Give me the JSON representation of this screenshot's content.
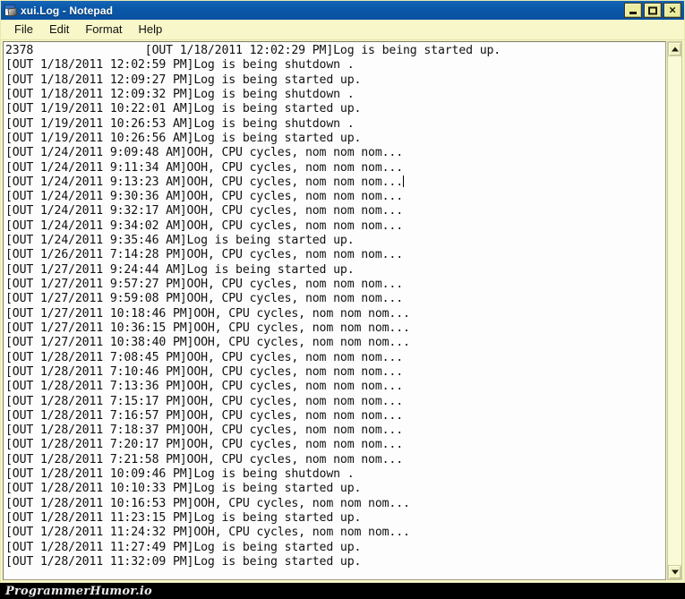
{
  "window": {
    "title": "xui.Log - Notepad",
    "icon": "notepad-icon",
    "colors": {
      "titlebar": "#0a57a8",
      "menubar": "#f7f7c9",
      "window_chrome": "#f2f2c4",
      "text_area": "#fdfdfd",
      "text": "#111111",
      "watermark_bar": "#000000"
    }
  },
  "window_buttons": {
    "minimize": "_",
    "maximize": "□",
    "close": "×"
  },
  "menu": {
    "items": [
      {
        "label": "File"
      },
      {
        "label": "Edit"
      },
      {
        "label": "Format"
      },
      {
        "label": "Help"
      }
    ]
  },
  "document": {
    "lines": [
      "2378                [OUT 1/18/2011 12:02:29 PM]Log is being started up.",
      "[OUT 1/18/2011 12:02:59 PM]Log is being shutdown .",
      "[OUT 1/18/2011 12:09:27 PM]Log is being started up.",
      "[OUT 1/18/2011 12:09:32 PM]Log is being shutdown .",
      "[OUT 1/19/2011 10:22:01 AM]Log is being started up.",
      "[OUT 1/19/2011 10:26:53 AM]Log is being shutdown .",
      "[OUT 1/19/2011 10:26:56 AM]Log is being started up.",
      "[OUT 1/24/2011 9:09:48 AM]OOH, CPU cycles, nom nom nom...",
      "[OUT 1/24/2011 9:11:34 AM]OOH, CPU cycles, nom nom nom...",
      "[OUT 1/24/2011 9:13:23 AM]OOH, CPU cycles, nom nom nom...",
      "[OUT 1/24/2011 9:30:36 AM]OOH, CPU cycles, nom nom nom...",
      "[OUT 1/24/2011 9:32:17 AM]OOH, CPU cycles, nom nom nom...",
      "[OUT 1/24/2011 9:34:02 AM]OOH, CPU cycles, nom nom nom...",
      "[OUT 1/24/2011 9:35:46 AM]Log is being started up.",
      "[OUT 1/26/2011 7:14:28 PM]OOH, CPU cycles, nom nom nom...",
      "[OUT 1/27/2011 9:24:44 AM]Log is being started up.",
      "[OUT 1/27/2011 9:57:27 PM]OOH, CPU cycles, nom nom nom...",
      "[OUT 1/27/2011 9:59:08 PM]OOH, CPU cycles, nom nom nom...",
      "[OUT 1/27/2011 10:18:46 PM]OOH, CPU cycles, nom nom nom...",
      "[OUT 1/27/2011 10:36:15 PM]OOH, CPU cycles, nom nom nom...",
      "[OUT 1/27/2011 10:38:40 PM]OOH, CPU cycles, nom nom nom...",
      "[OUT 1/28/2011 7:08:45 PM]OOH, CPU cycles, nom nom nom...",
      "[OUT 1/28/2011 7:10:46 PM]OOH, CPU cycles, nom nom nom...",
      "[OUT 1/28/2011 7:13:36 PM]OOH, CPU cycles, nom nom nom...",
      "[OUT 1/28/2011 7:15:17 PM]OOH, CPU cycles, nom nom nom...",
      "[OUT 1/28/2011 7:16:57 PM]OOH, CPU cycles, nom nom nom...",
      "[OUT 1/28/2011 7:18:37 PM]OOH, CPU cycles, nom nom nom...",
      "[OUT 1/28/2011 7:20:17 PM]OOH, CPU cycles, nom nom nom...",
      "[OUT 1/28/2011 7:21:58 PM]OOH, CPU cycles, nom nom nom...",
      "[OUT 1/28/2011 10:09:46 PM]Log is being shutdown .",
      "[OUT 1/28/2011 10:10:33 PM]Log is being started up.",
      "[OUT 1/28/2011 10:16:53 PM]OOH, CPU cycles, nom nom nom...",
      "[OUT 1/28/2011 11:23:15 PM]Log is being started up.",
      "[OUT 1/28/2011 11:24:32 PM]OOH, CPU cycles, nom nom nom...",
      "[OUT 1/28/2011 11:27:49 PM]Log is being started up.",
      "[OUT 1/28/2011 11:32:09 PM]Log is being started up."
    ],
    "caret_line_index": 9
  },
  "scrollbar": {
    "up_arrow": "▲",
    "down_arrow": "▼"
  },
  "watermark": {
    "text": "ProgrammerHumor.io"
  }
}
